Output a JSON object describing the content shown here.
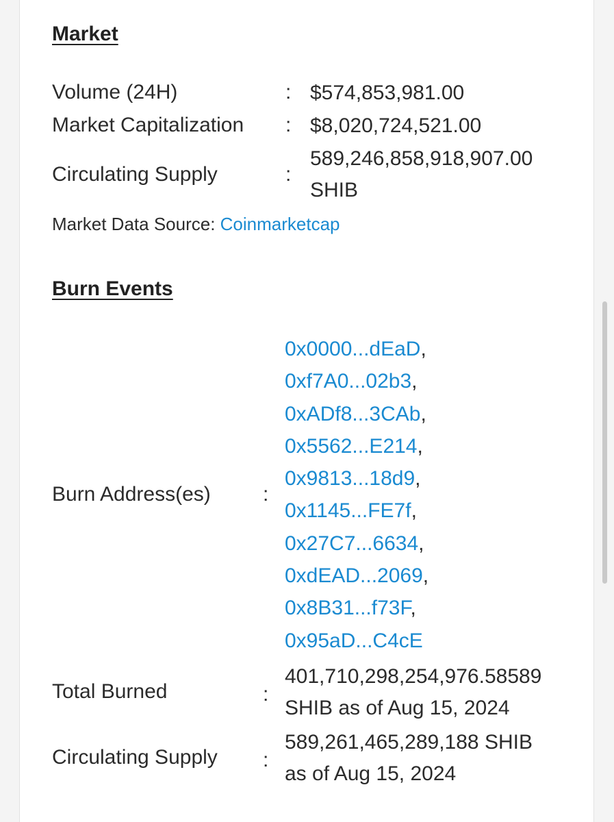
{
  "market": {
    "title": "Market",
    "volume_label": "Volume (24H)",
    "volume_value": "$574,853,981.00",
    "market_cap_label": "Market Capitalization",
    "market_cap_value": "$8,020,724,521.00",
    "circ_supply_label": "Circulating Supply",
    "circ_supply_value_line1": "589,246,858,918,907.00",
    "circ_supply_value_line2": "SHIB",
    "source_prefix": "Market Data Source: ",
    "source_link": "Coinmarketcap",
    "colon": ":"
  },
  "burn": {
    "title": "Burn Events",
    "addresses_label": "Burn Address(es)",
    "addresses": [
      "0x0000...dEaD",
      "0xf7A0...02b3",
      "0xADf8...3CAb",
      "0x5562...E214",
      "0x9813...18d9",
      "0x1145...FE7f",
      "0x27C7...6634",
      "0xdEAD...2069",
      "0x8B31...f73F",
      "0x95aD...C4cE"
    ],
    "separator": ",",
    "total_burned_label": "Total Burned",
    "total_burned_line1": "401,710,298,254,976.58589",
    "total_burned_line2": "SHIB as of Aug 15, 2024",
    "circ_supply_label": "Circulating Supply",
    "circ_supply_line1": "589,261,465,289,188 SHIB",
    "circ_supply_line2": "as of Aug 15, 2024"
  },
  "colors": {
    "link": "#1a8ad1",
    "text": "#2b2b2b",
    "background": "#ffffff"
  }
}
